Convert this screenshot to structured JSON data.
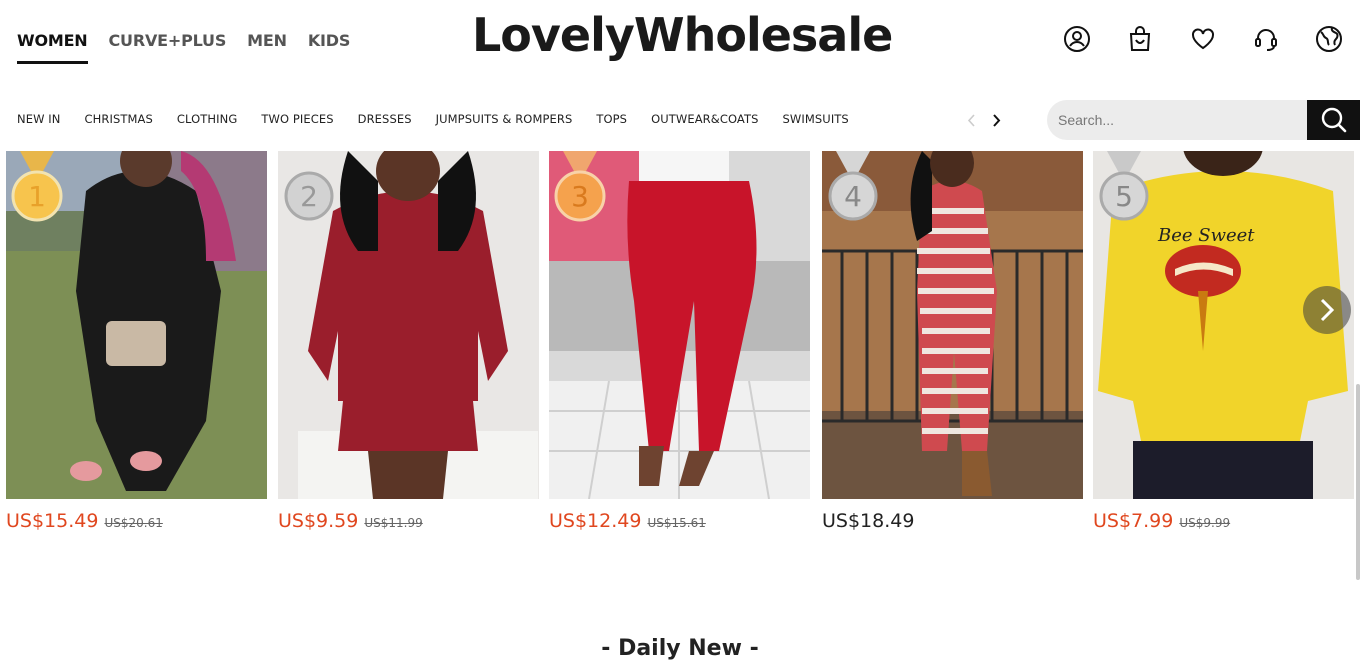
{
  "header": {
    "tabs": [
      {
        "label": "WOMEN",
        "active": true
      },
      {
        "label": "CURVE+PLUS",
        "active": false
      },
      {
        "label": "MEN",
        "active": false
      },
      {
        "label": "KIDS",
        "active": false
      }
    ],
    "logo": "LovelyWholesale",
    "icons": [
      "account-icon",
      "shopping-bag-icon",
      "wishlist-heart-icon",
      "customer-service-icon",
      "globe-icon"
    ]
  },
  "category_nav": {
    "items": [
      "NEW IN",
      "CHRISTMAS",
      "CLOTHING",
      "TWO PIECES",
      "DRESSES",
      "JUMPSUITS & ROMPERS",
      "TOPS",
      "OUTWEAR&COATS",
      "SWIMSUITS"
    ]
  },
  "search": {
    "placeholder": "Search..."
  },
  "products": [
    {
      "rank": "1",
      "price": "US$15.49",
      "original_price": "US$20.61",
      "on_sale": true,
      "medal": "gold"
    },
    {
      "rank": "2",
      "price": "US$9.59",
      "original_price": "US$11.99",
      "on_sale": true,
      "medal": "silver"
    },
    {
      "rank": "3",
      "price": "US$12.49",
      "original_price": "US$15.61",
      "on_sale": true,
      "medal": "bronze"
    },
    {
      "rank": "4",
      "price": "US$18.49",
      "original_price": "",
      "on_sale": false,
      "medal": "silver"
    },
    {
      "rank": "5",
      "price": "US$7.99",
      "original_price": "US$9.99",
      "on_sale": true,
      "medal": "silver"
    }
  ],
  "product_image_text": "Bee Sweet",
  "section_title": "- Daily New -",
  "colors": {
    "sale_price": "#e0471f",
    "black": "#111111",
    "search_bg": "#ececec"
  }
}
